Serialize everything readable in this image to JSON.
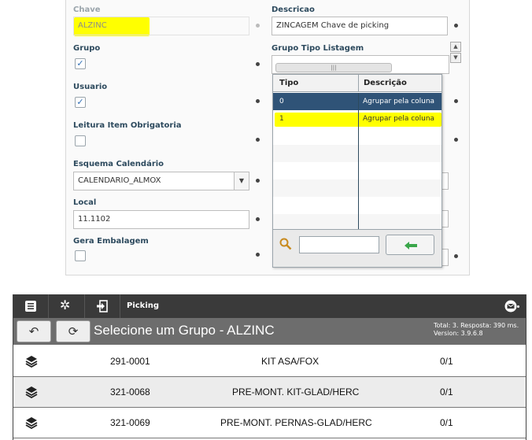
{
  "form": {
    "chave": {
      "label": "Chave",
      "value": "ALZINC"
    },
    "descricao": {
      "label": "Descricao",
      "value": "ZINCAGEM Chave de picking"
    },
    "grupo": {
      "label": "Grupo",
      "checked": true
    },
    "grupo_tipo": {
      "label": "Grupo Tipo Listagem",
      "scroll_thumb": "|||"
    },
    "usuario": {
      "label": "Usuario",
      "checked": true
    },
    "leitura": {
      "label": "Leitura Item Obrigatoria",
      "checked": false
    },
    "esquema": {
      "label": "Esquema Calendário",
      "value": "CALENDARIO_ALMOX"
    },
    "local": {
      "label": "Local",
      "value": "11.1102"
    },
    "gera": {
      "label": "Gera Embalagem",
      "checked": false
    }
  },
  "dropdown": {
    "columns": [
      "Tipo",
      "Descrição"
    ],
    "rows": [
      {
        "tipo": "0",
        "descricao": "Agrupar pela coluna",
        "selected": true
      },
      {
        "tipo": "1",
        "descricao": "Agrupar pela coluna",
        "highlighted": true
      }
    ],
    "search_value": ""
  },
  "app": {
    "title": "Picking",
    "page_title": "Selecione um Grupo - ALZINC",
    "status_line1": "Total: 3. Resposta: 390 ms.",
    "status_line2": "Version: 3.9.6.8",
    "rows": [
      {
        "code": "291-0001",
        "name": "KIT ASA/FOX",
        "qty": "0/1"
      },
      {
        "code": "321-0068",
        "name": "PRE-MONT. KIT-GLAD/HERC",
        "qty": "0/1"
      },
      {
        "code": "321-0069",
        "name": "PRE-MONT. PERNAS-GLAD/HERC",
        "qty": "0/1"
      }
    ]
  },
  "colors": {
    "highlight": "#ffff00",
    "selected_row": "#2f5377",
    "label": "#2d4a5e",
    "topbar": "#3a3a3a",
    "subbar": "#6d6d6d"
  }
}
